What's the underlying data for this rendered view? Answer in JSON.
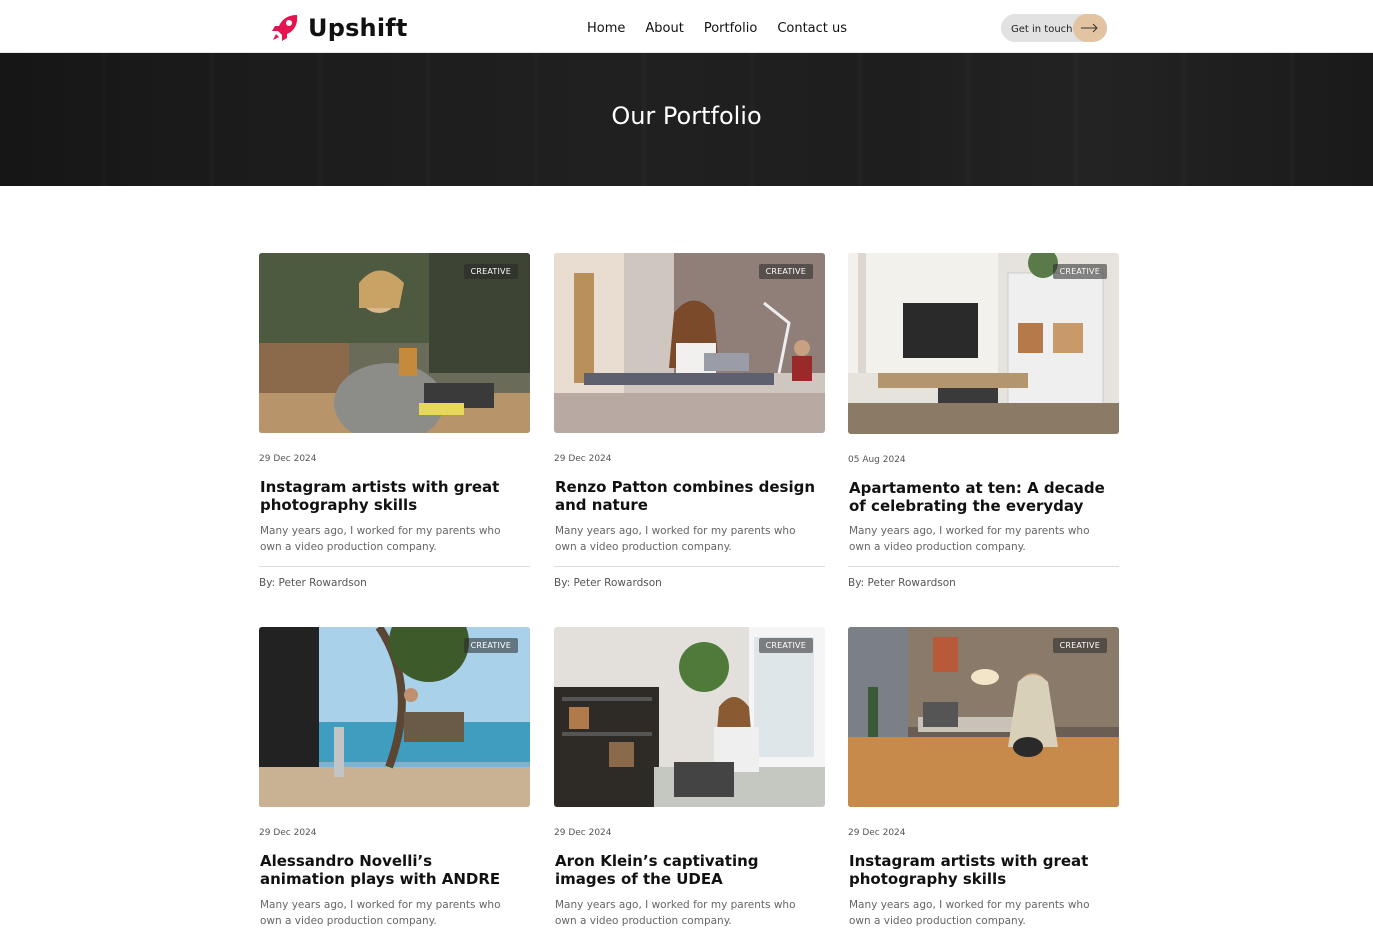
{
  "brand": {
    "name": "Upshift",
    "accent": "#e3144f"
  },
  "nav": {
    "items": [
      "Home",
      "About",
      "Portfolio",
      "Contact us"
    ]
  },
  "cta": {
    "label": "Get in touch",
    "icon": "arrow-right-icon"
  },
  "hero": {
    "title": "Our Portfolio"
  },
  "cards": [
    {
      "tag": "CREATIVE",
      "date": "29 Dec 2024",
      "title": "Instagram artists with great photography skills",
      "description": "Many years ago, I worked for my parents who own a video production company.",
      "author": "By: Peter Rowardson"
    },
    {
      "tag": "CREATIVE",
      "date": "29 Dec 2024",
      "title": "Renzo Patton combines design and nature",
      "description": "Many years ago, I worked for my parents who own a video production company.",
      "author": "By: Peter Rowardson"
    },
    {
      "tag": "CREATIVE",
      "date": "05 Aug 2024",
      "title": "Apartamento at ten: A decade of celebrating the everyday",
      "description": "Many years ago, I worked for my parents who own a video production company.",
      "author": "By: Peter Rowardson"
    },
    {
      "tag": "CREATIVE",
      "date": "29 Dec 2024",
      "title": "Alessandro Novelli’s animation plays with ANDRE",
      "description": "Many years ago, I worked for my parents who own a video production company."
    },
    {
      "tag": "CREATIVE",
      "date": "29 Dec 2024",
      "title": "Aron Klein’s captivating images of the UDEA",
      "description": "Many years ago, I worked for my parents who own a video production company."
    },
    {
      "tag": "CREATIVE",
      "date": "29 Dec 2024",
      "title": "Instagram artists with great photography skills",
      "description": "Many years ago, I worked for my parents who own a video production company."
    }
  ]
}
